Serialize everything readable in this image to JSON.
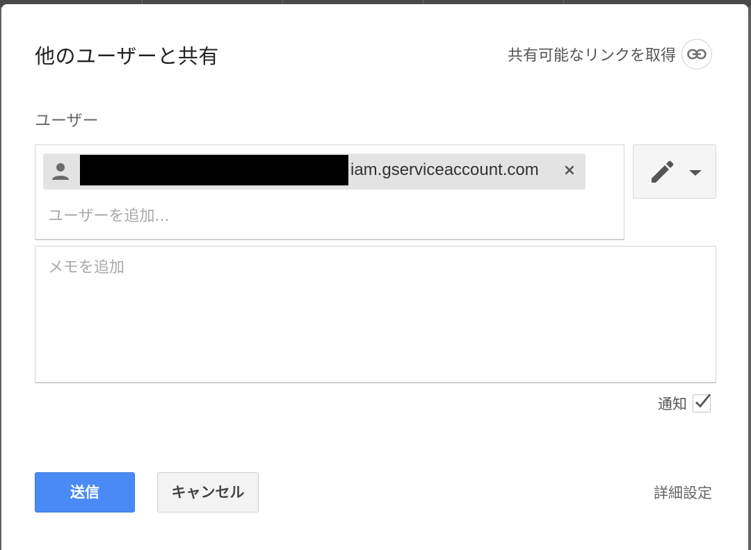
{
  "dialog": {
    "title": "他のユーザーと共有",
    "get_link_label": "共有可能なリンクを取得",
    "link_icon": "link-icon"
  },
  "people": {
    "section_label": "ユーザー",
    "chips": [
      {
        "email_visible": "iam.gserviceaccount.com",
        "icon": "person-icon",
        "remove_glyph": "×",
        "redacted": true
      }
    ],
    "add_placeholder": "ユーザーを追加...",
    "permission_icon": "pencil-icon"
  },
  "note": {
    "placeholder": "メモを追加"
  },
  "notify": {
    "label": "通知",
    "checked": true
  },
  "footer": {
    "send_label": "送信",
    "cancel_label": "キャンセル",
    "advanced_label": "詳細設定"
  },
  "colors": {
    "primary": "#4a8af4",
    "chip_bg": "#e3e3e3"
  }
}
